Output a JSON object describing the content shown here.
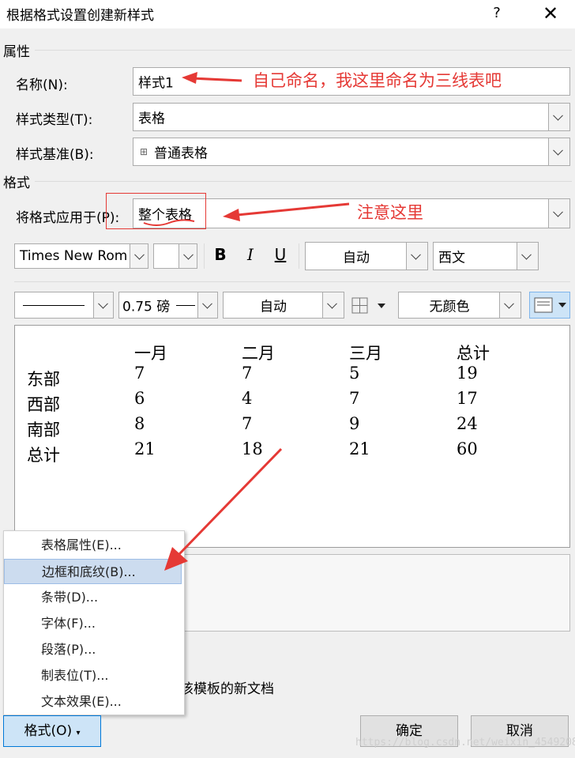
{
  "dialog": {
    "title": "根据格式设置创建新样式",
    "help": "?",
    "close": "✕"
  },
  "properties": {
    "group_title": "属性",
    "name_label": "名称(N):",
    "name_value": "样式1",
    "type_label": "样式类型(T):",
    "type_value": "表格",
    "base_label": "样式基准(B):",
    "base_icon": "⊞",
    "base_value": "普通表格"
  },
  "format": {
    "group_title": "格式",
    "apply_label": "将格式应用于(P):",
    "apply_value": "整个表格",
    "font_name": "Times New Roma",
    "font_size": "",
    "bold": "B",
    "italic": "I",
    "underline": "U",
    "font_color": "自动",
    "script": "西文",
    "line_width": "0.75 磅",
    "border_color": "自动",
    "shading": "无颜色"
  },
  "annotations": {
    "name_note": "自己命名，我这里命名为三线表吧",
    "apply_note": "注意这里"
  },
  "preview": {
    "headers": [
      "",
      "一月",
      "二月",
      "三月",
      "总计"
    ],
    "rows": [
      [
        "东部",
        "7",
        "7",
        "5",
        "19"
      ],
      [
        "西部",
        "6",
        "4",
        "7",
        "17"
      ],
      [
        "南部",
        "8",
        "7",
        "9",
        "24"
      ],
      [
        "总计",
        "21",
        "18",
        "21",
        "60"
      ]
    ]
  },
  "menu": {
    "items": [
      "表格属性(E)...",
      "边框和底纹(B)...",
      "条带(D)...",
      "字体(F)...",
      "段落(P)...",
      "制表位(T)...",
      "文本效果(E)..."
    ]
  },
  "footer": {
    "template_text_partial": "该模板的新文档",
    "format_button": "格式(O)",
    "ok_button": "确定",
    "cancel_button": "取消",
    "watermark": "https://blog.csdn.net/weixin_45492081"
  },
  "colors": {
    "annotation": "#e53935",
    "menu_highlight": "#ccdcef",
    "format_button": "#cde4f7"
  }
}
